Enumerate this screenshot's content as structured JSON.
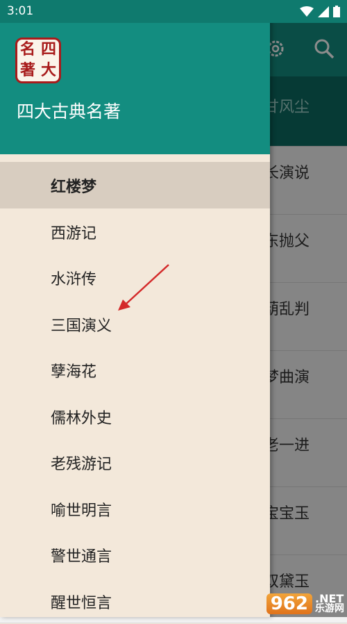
{
  "status_bar": {
    "time": "3:01"
  },
  "main": {
    "toolbar_icons": [
      "gear-icon",
      "search-icon"
    ],
    "rows": [
      "甘风尘",
      "长演说",
      "东抛父",
      "葫乱判",
      "梦曲演",
      "老一进",
      "宝宝玉",
      "双黛玉"
    ]
  },
  "drawer": {
    "title": "四大古典名著",
    "logo_text": [
      "名",
      "四",
      "著",
      "大"
    ],
    "items": [
      {
        "label": "红楼梦",
        "selected": true
      },
      {
        "label": "西游记"
      },
      {
        "label": "水浒传"
      },
      {
        "label": "三国演义"
      },
      {
        "label": "孽海花"
      },
      {
        "label": "儒林外史"
      },
      {
        "label": "老残游记"
      },
      {
        "label": "喻世明言"
      },
      {
        "label": "警世通言"
      },
      {
        "label": "醒世恒言"
      }
    ]
  },
  "watermark": {
    "number": "962",
    "text_top": ".NET",
    "text_bottom": "乐游网"
  },
  "colors": {
    "primary": "#138d80",
    "drawer_bg": "#f3e8da",
    "selected_bg": "#d8cdc0",
    "annotation": "#d42a2a"
  }
}
